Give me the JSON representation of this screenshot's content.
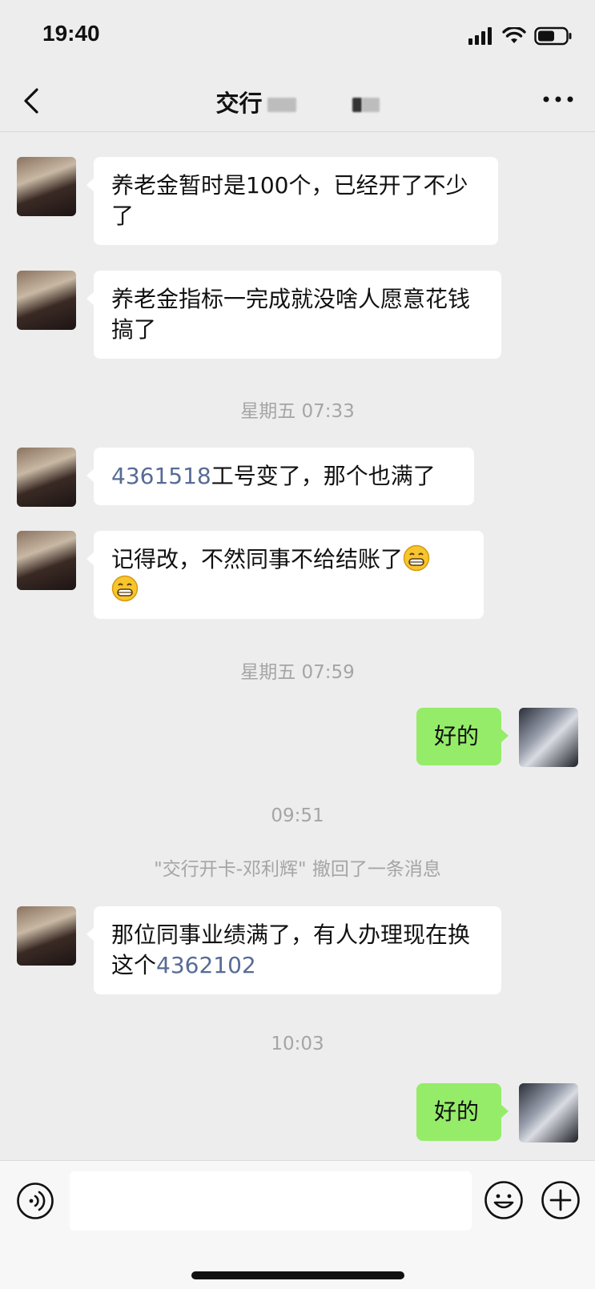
{
  "status": {
    "time": "19:40"
  },
  "nav": {
    "title": "交行"
  },
  "messages": [
    {
      "text": "养老金暂时是100个，已经开了不少了"
    },
    {
      "text": "养老金指标一完成就没啥人愿意花钱搞了"
    },
    {
      "link": "4361518",
      "text": "工号变了，那个也满了"
    },
    {
      "text": "记得改，不然同事不给结账了"
    },
    {
      "text": "好的"
    },
    {
      "text": "那位同事业绩满了，有人办理现在换这个",
      "link": "4362102"
    },
    {
      "text": "好的"
    }
  ],
  "timestamps": [
    "星期五 07:33",
    "星期五 07:59",
    "09:51",
    "10:03"
  ],
  "recall_notice": "\"交行开卡-邓利辉\" 撤回了一条消息",
  "icons": [
    "back-icon",
    "more-icon",
    "voice-icon",
    "emoji-icon",
    "plus-icon",
    "grinning-emoji"
  ],
  "colors": {
    "incoming_bubble": "#ffffff",
    "outgoing_bubble": "#95ec69",
    "link": "#576b95",
    "background": "#ededed"
  }
}
